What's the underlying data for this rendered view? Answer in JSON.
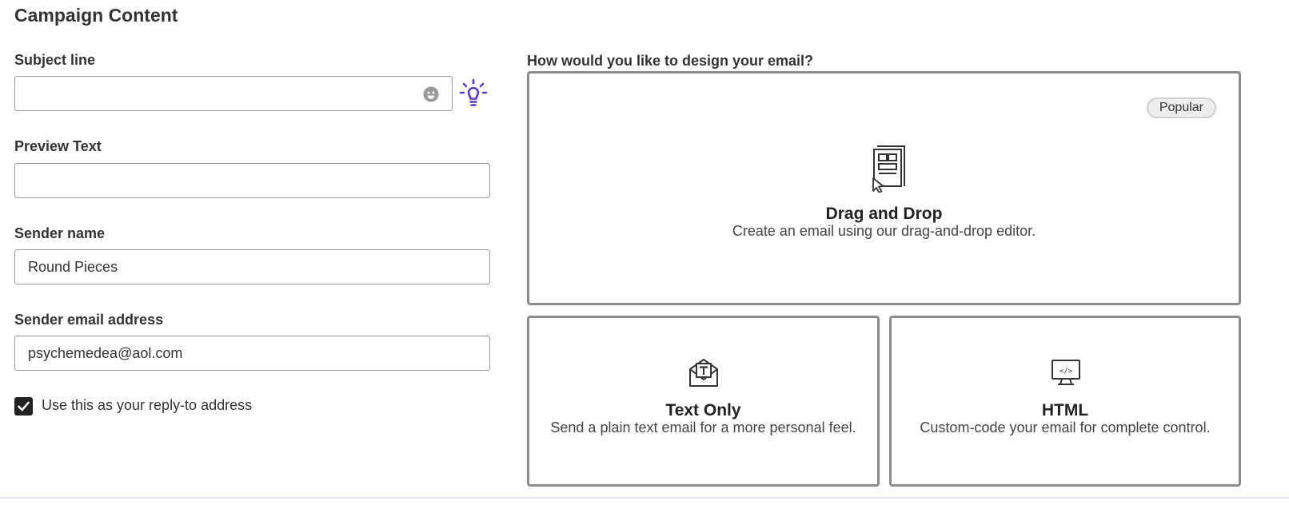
{
  "page": {
    "title": "Campaign Content"
  },
  "form": {
    "subject": {
      "label": "Subject line",
      "value": "",
      "placeholder": ""
    },
    "preview": {
      "label": "Preview Text",
      "value": "",
      "placeholder": ""
    },
    "sender_name": {
      "label": "Sender name",
      "value": "Round Pieces"
    },
    "sender_email": {
      "label": "Sender email address",
      "value": "psychemedea@aol.com"
    },
    "reply_to": {
      "label": "Use this as your reply-to address",
      "checked": true
    }
  },
  "design": {
    "question": "How would you like to design your email?",
    "options": [
      {
        "title": "Drag and Drop",
        "description": "Create an email using our drag-and-drop editor.",
        "badge": "Popular",
        "icon": "drag-drop-icon"
      },
      {
        "title": "Text Only",
        "description": "Send a plain text email for a more personal feel.",
        "icon": "text-envelope-icon"
      },
      {
        "title": "HTML",
        "description": "Custom-code your email for complete control.",
        "icon": "code-monitor-icon"
      }
    ]
  },
  "colors": {
    "accent": "#5b3fc2",
    "border": "#8c8c8c",
    "checkbox": "#222222"
  }
}
